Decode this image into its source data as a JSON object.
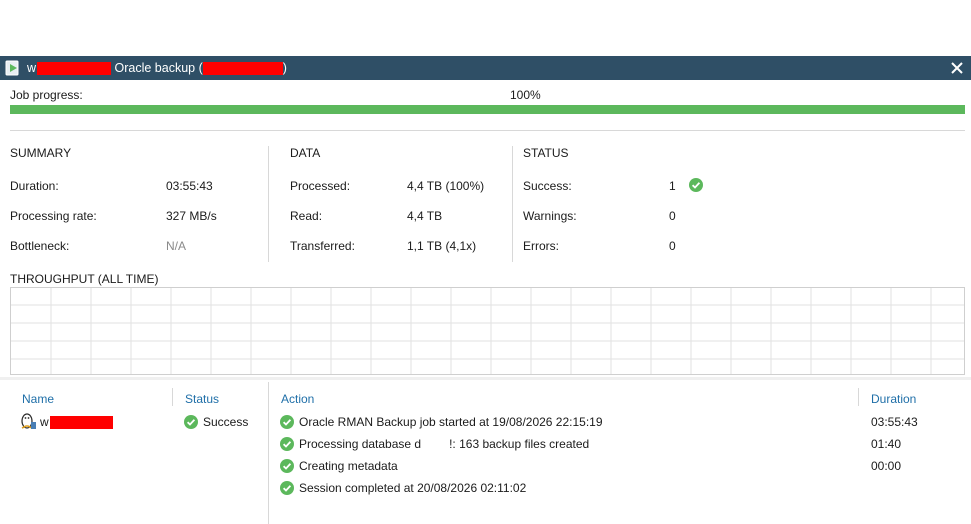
{
  "window": {
    "title_prefix": "w",
    "title_mid": " Oracle backup (",
    "title_suffix": ")",
    "close_glyph": "✕",
    "icon": "backup-job-icon"
  },
  "progress": {
    "label": "Job progress:",
    "percent_text": "100%",
    "value": 1.0,
    "color": "#5cb85c"
  },
  "summary": {
    "heading": "SUMMARY",
    "rows": [
      {
        "label": "Duration:",
        "value": "03:55:43"
      },
      {
        "label": "Processing rate:",
        "value": "327 MB/s"
      },
      {
        "label": "Bottleneck:",
        "value": "N/A"
      }
    ]
  },
  "data_section": {
    "heading": "DATA",
    "rows": [
      {
        "label": "Processed:",
        "value": "4,4 TB (100%)"
      },
      {
        "label": "Read:",
        "value": "4,4 TB"
      },
      {
        "label": "Transferred:",
        "value": "1,1 TB (4,1x)"
      }
    ]
  },
  "status_section": {
    "heading": "STATUS",
    "rows": [
      {
        "label": "Success:",
        "value": "1"
      },
      {
        "label": "Warnings:",
        "value": "0"
      },
      {
        "label": "Errors:",
        "value": "0"
      }
    ]
  },
  "throughput": {
    "heading": "THROUGHPUT (ALL TIME)"
  },
  "objects_table": {
    "headers": {
      "name": "Name",
      "status": "Status"
    },
    "rows": [
      {
        "name_prefix": "w",
        "status": "Success"
      }
    ]
  },
  "log_table": {
    "headers": {
      "action": "Action",
      "duration": "Duration"
    },
    "rows": [
      {
        "action": "Oracle RMAN Backup job started at 19/08/2026 22:15:19",
        "duration": "03:55:43"
      },
      {
        "action_a": "Processing database d",
        "action_b": "!: 163 backup files created",
        "duration": "01:40"
      },
      {
        "action": "Creating metadata",
        "duration": "00:00"
      },
      {
        "action": "Session completed at 20/08/2026 02:11:02",
        "duration": ""
      }
    ]
  },
  "colors": {
    "titlebar": "#2f4f66",
    "success_green": "#5cb85c",
    "header_blue": "#1f6fa8",
    "redaction": "#ff0000"
  }
}
